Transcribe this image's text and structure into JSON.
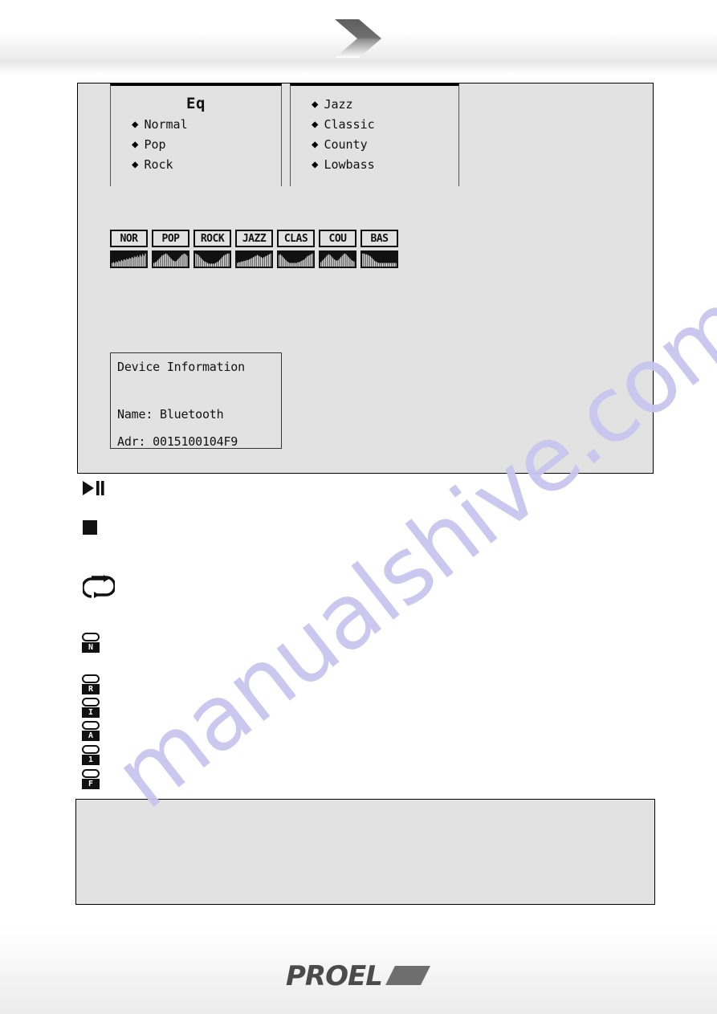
{
  "header": {
    "chevron_icon": "chevron-right-icon",
    "chevron_color": "#6b6b6b"
  },
  "screen": {
    "eq_menu": {
      "title": "Eq",
      "left_column": [
        {
          "bullet": "◆",
          "label": "Normal"
        },
        {
          "bullet": "◆",
          "label": "Pop"
        },
        {
          "bullet": "◆",
          "label": "Rock"
        }
      ],
      "right_column": [
        {
          "bullet": "◆",
          "label": "Jazz"
        },
        {
          "bullet": "◆",
          "label": "Classic"
        },
        {
          "bullet": "◆",
          "label": "County"
        },
        {
          "bullet": "◆",
          "label": "Lowbass"
        }
      ]
    },
    "eq_presets": [
      {
        "tag": "NOR",
        "name": "normal",
        "bars": [
          5,
          6,
          5,
          7,
          6,
          8,
          7,
          9,
          8,
          10,
          9,
          11,
          10,
          12,
          11,
          13,
          12,
          14,
          13,
          15,
          13,
          16,
          14,
          17,
          15,
          18
        ]
      },
      {
        "tag": "POP",
        "name": "pop",
        "bars": [
          5,
          6,
          7,
          9,
          11,
          13,
          15,
          16,
          17,
          18,
          17,
          15,
          13,
          11,
          9,
          8,
          7,
          8,
          10,
          12,
          14,
          16,
          17,
          18,
          17,
          15
        ]
      },
      {
        "tag": "ROCK",
        "name": "rock",
        "bars": [
          18,
          17,
          16,
          14,
          12,
          10,
          8,
          7,
          6,
          5,
          4,
          4,
          4,
          4,
          4,
          5,
          6,
          7,
          9,
          11,
          13,
          15,
          16,
          17,
          18,
          18
        ]
      },
      {
        "tag": "JAZZ",
        "name": "jazz",
        "bars": [
          5,
          6,
          6,
          7,
          7,
          8,
          8,
          9,
          9,
          10,
          11,
          12,
          13,
          14,
          15,
          16,
          15,
          14,
          13,
          12,
          13,
          14,
          15,
          16,
          17,
          18
        ]
      },
      {
        "tag": "CLAS",
        "name": "classic",
        "bars": [
          16,
          17,
          15,
          13,
          11,
          9,
          7,
          6,
          5,
          5,
          5,
          5,
          5,
          5,
          6,
          6,
          7,
          8,
          9,
          10,
          12,
          14,
          15,
          16,
          17,
          18
        ]
      },
      {
        "tag": "COU",
        "name": "county",
        "bars": [
          6,
          8,
          10,
          12,
          14,
          16,
          17,
          16,
          14,
          12,
          10,
          9,
          8,
          9,
          11,
          13,
          15,
          17,
          18,
          17,
          15,
          13,
          11,
          9,
          8,
          7
        ]
      },
      {
        "tag": "BAS",
        "name": "lowbass",
        "bars": [
          18,
          18,
          17,
          17,
          16,
          15,
          14,
          12,
          10,
          8,
          7,
          6,
          5,
          5,
          5,
          5,
          5,
          5,
          5,
          5,
          5,
          5,
          5,
          5,
          5,
          5
        ]
      }
    ],
    "device_information": {
      "title": "Device Information",
      "name_line": "Name: Bluetooth",
      "address_line": "Adr: 0015100104F9"
    }
  },
  "transport_icons": [
    {
      "name": "play-pause-icon",
      "glyph": "play-pause"
    },
    {
      "name": "stop-icon",
      "glyph": "stop"
    },
    {
      "name": "repeat-icon",
      "glyph": "repeat"
    }
  ],
  "status_badges": [
    {
      "name": "status-badge-n",
      "letter": "N"
    },
    {
      "name": "status-badge-r",
      "letter": "R"
    },
    {
      "name": "status-badge-i",
      "letter": "I"
    },
    {
      "name": "status-badge-a",
      "letter": "A"
    },
    {
      "name": "status-badge-1",
      "letter": "1"
    },
    {
      "name": "status-badge-f",
      "letter": "F"
    }
  ],
  "note_box": {
    "text": ""
  },
  "footer": {
    "brand": "PROEL",
    "mark_color": "#6e6e6e",
    "wordmark_color": "#4b4b4b"
  },
  "watermark": {
    "text": "manualshive.com",
    "color": "#c9c6ef"
  },
  "colors": {
    "screen_background": "#e2e2e2",
    "ink": "#111111",
    "page_background": "#ffffff"
  }
}
